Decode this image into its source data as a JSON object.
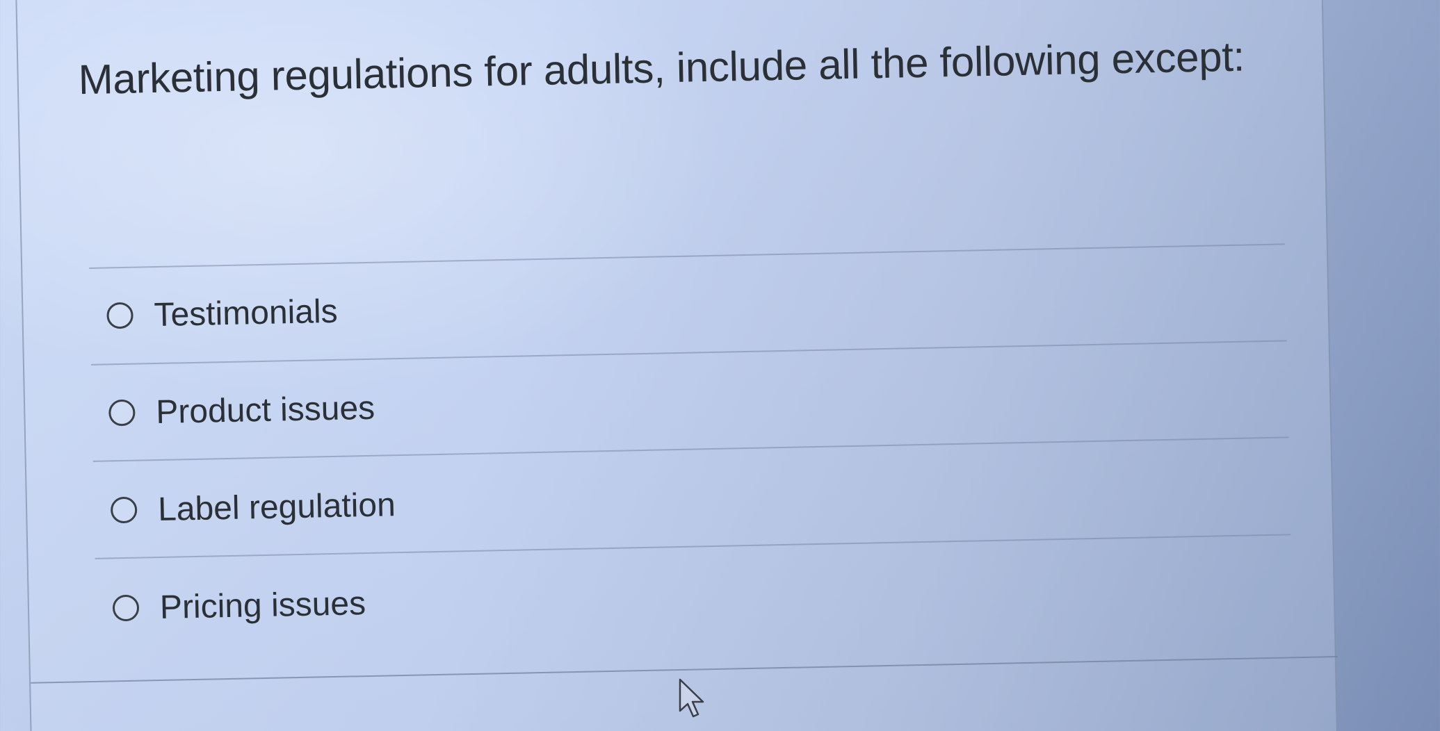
{
  "question": {
    "text": "Marketing regulations for adults, include all the following except:"
  },
  "options": [
    {
      "label": "Testimonials",
      "selected": false
    },
    {
      "label": "Product issues",
      "selected": false
    },
    {
      "label": "Label regulation",
      "selected": false
    },
    {
      "label": "Pricing issues",
      "selected": false
    }
  ],
  "icons": {
    "cursor": "mouse-pointer-icon",
    "radio": "radio-circle-icon"
  }
}
